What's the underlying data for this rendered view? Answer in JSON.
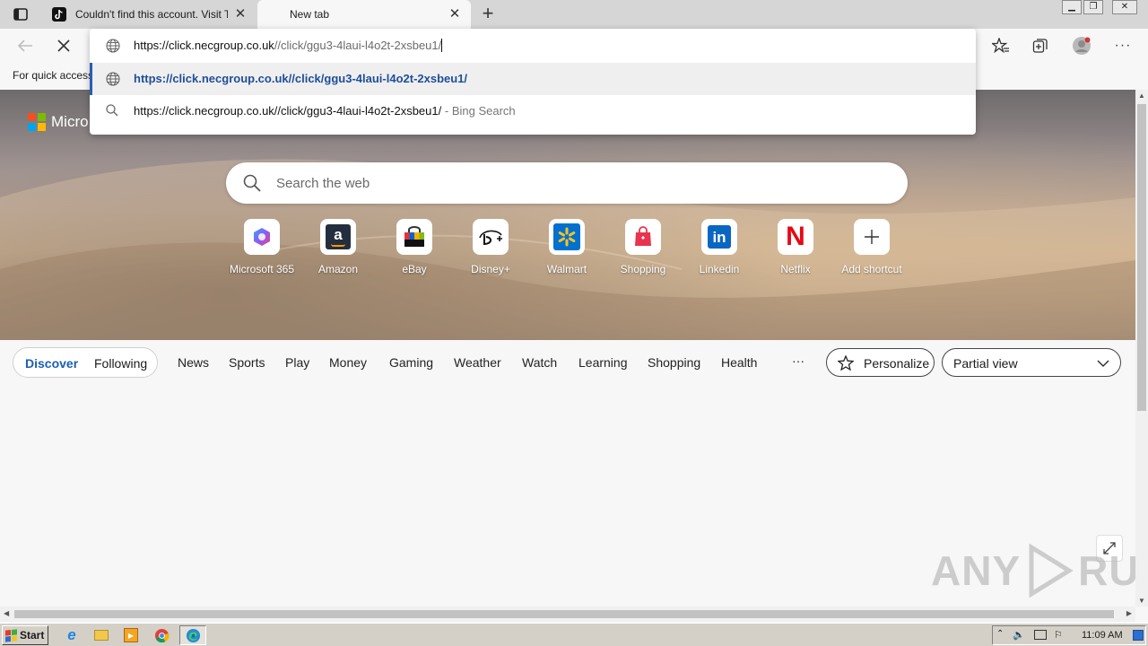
{
  "tabs": [
    {
      "title": "Couldn't find this account. Visit T",
      "favicon": "tiktok-icon"
    },
    {
      "title": "New tab",
      "favicon": "none"
    }
  ],
  "toolbar": {
    "reload_state": "stop"
  },
  "omnibox": {
    "value_host": "https://click.necgroup.co.uk",
    "value_path": "//click/ggu3-4laui-l4o2t-2xsbeu1/",
    "suggestions": [
      {
        "text": "https://click.necgroup.co.uk//click/ggu3-4laui-l4o2t-2xsbeu1/",
        "suffix": "",
        "icon": "globe-icon"
      },
      {
        "text": "https://click.necgroup.co.uk//click/ggu3-4laui-l4o2t-2xsbeu1/",
        "suffix": "- Bing Search",
        "icon": "search-icon"
      }
    ]
  },
  "favorites_bar": {
    "text": "For quick access"
  },
  "hero": {
    "brand": "Micro",
    "search_placeholder": "Search the web",
    "shortcuts": [
      {
        "label": "Microsoft 365",
        "icon": "microsoft365-icon"
      },
      {
        "label": "Amazon",
        "icon": "amazon-icon"
      },
      {
        "label": "eBay",
        "icon": "ebay-icon"
      },
      {
        "label": "Disney+",
        "icon": "disney-icon"
      },
      {
        "label": "Walmart",
        "icon": "walmart-icon"
      },
      {
        "label": "Shopping",
        "icon": "shopping-icon"
      },
      {
        "label": "Linkedin",
        "icon": "linkedin-icon"
      },
      {
        "label": "Netflix",
        "icon": "netflix-icon"
      },
      {
        "label": "Add shortcut",
        "icon": "plus-icon"
      }
    ]
  },
  "feed": {
    "discover": "Discover",
    "following": "Following",
    "nav": [
      "News",
      "Sports",
      "Play",
      "Money",
      "Gaming",
      "Weather",
      "Watch",
      "Learning",
      "Shopping",
      "Health",
      "···"
    ],
    "personalize": "Personalize",
    "view": "Partial view"
  },
  "watermark": {
    "left": "ANY",
    "right": "RUN"
  },
  "taskbar": {
    "start": "Start",
    "clock": "11:09 AM"
  },
  "colors": {
    "accent": "#1a5fb4",
    "suggestion_link": "#1f4e99",
    "taskbar": "#d4d0c8"
  }
}
